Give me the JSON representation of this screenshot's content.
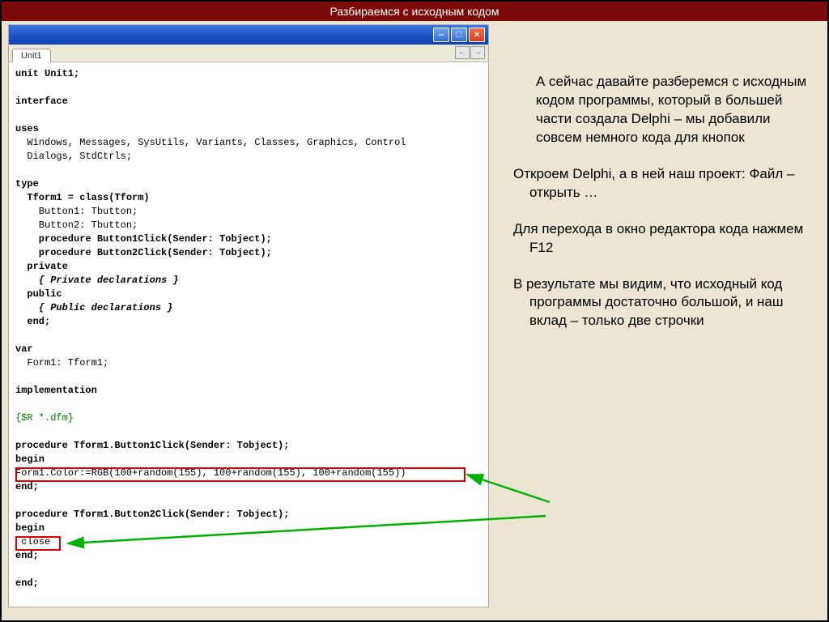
{
  "slide": {
    "title": "Разбираемся с исходным кодом"
  },
  "window": {
    "tab": "Unit1",
    "nav_back": "←",
    "nav_fwd": "→",
    "min_glyph": "–",
    "max_glyph": "□",
    "close_glyph": "×"
  },
  "code": {
    "l1": "unit Unit1;",
    "l2": "interface",
    "l3": "uses",
    "l4": "  Windows, Messages, SysUtils, Variants, Classes, Graphics, Control",
    "l5": "  Dialogs, StdCtrls;",
    "l6": "type",
    "l7": "  Tform1 = class(Tform)",
    "l8": "    Button1: Tbutton;",
    "l9": "    Button2: Tbutton;",
    "l10": "    procedure Button1Click(Sender: Tobject);",
    "l11": "    procedure Button2Click(Sender: Tobject);",
    "l12": "  private",
    "l13": "    { Private declarations }",
    "l14": "  public",
    "l15": "    { Public declarations }",
    "l16": "  end;",
    "l17": "var",
    "l18": "  Form1: Tform1;",
    "l19": "implementation",
    "l20": "{$R *.dfm}",
    "l21": "procedure Tform1.Button1Click(Sender: Tobject);",
    "l22": "begin",
    "l23": "Form1.Color:=RGB(100+random(155), 100+random(155), 100+random(155))",
    "l24": "end;",
    "l25": "procedure Tform1.Button2Click(Sender: Tobject);",
    "l26": "begin",
    "l27": " close",
    "l28": "end;",
    "l29": "end;"
  },
  "notes": {
    "p1": "  А сейчас давайте разберемся с исходным кодом программы, который в большей части создала Delphi – мы добавили совсем немного кода для кнопок",
    "p2": "Откроем  Delphi, а в ней наш проект: Файл – открыть …",
    "p3": "Для перехода в окно редактора кода нажмем F12",
    "p4": "В результате мы видим, что исходный код программы достаточно большой, и наш вклад – только две строчки"
  }
}
